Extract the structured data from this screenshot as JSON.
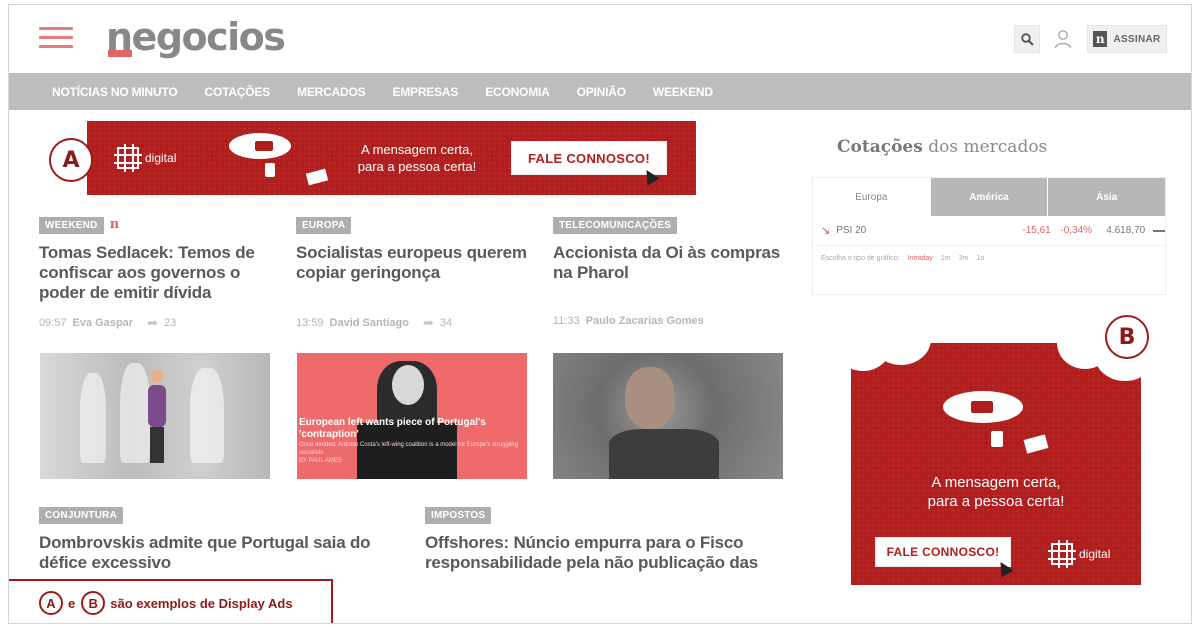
{
  "header": {
    "logo": "negocios",
    "assinar_label": "ASSINAR",
    "assinar_badge": "n"
  },
  "nav": {
    "items": [
      "NOTÍCIAS NO MINUTO",
      "COTAÇÕES",
      "MERCADOS",
      "EMPRESAS",
      "ECONOMIA",
      "OPINIÃO",
      "WEEKEND"
    ]
  },
  "ad_a": {
    "label": "A",
    "brand": "digital",
    "message_line1": "A mensagem certa,",
    "message_line2": "para a pessoa certa!",
    "cta": "FALE CONNOSCO!"
  },
  "ad_b": {
    "label": "B",
    "brand": "digital",
    "message_line1": "A mensagem certa,",
    "message_line2": "para a pessoa certa!",
    "cta": "FALE CONNOSCO!"
  },
  "articles": [
    {
      "tag": "WEEKEND",
      "tag_badge": "n",
      "headline": "Tomas Sedlacek: Temos de confiscar aos governos o poder de emitir dívida",
      "time": "09:57",
      "author": "Eva Gaspar",
      "shares": "23"
    },
    {
      "tag": "EUROPA",
      "headline": "Socialistas europeus querem copiar geringonça",
      "time": "13:59",
      "author": "David Santiago",
      "shares": "34"
    },
    {
      "tag": "TELECOMUNICAÇÕES",
      "headline": "Accionista da Oi às compras na Pharol",
      "time": "11:33",
      "author": "Paulo Zacarias Gomes",
      "shares": ""
    }
  ],
  "photo_caption": {
    "title": "European left wants piece of Portugal's 'contraption'",
    "text": "Once derided, António Costa's left-wing coalition is a model for Europe's struggling socialists",
    "byline": "BY PAUL AMES"
  },
  "bottom_articles": [
    {
      "tag": "CONJUNTURA",
      "headline": "Dombrovskis admite que Portugal saia do défice excessivo"
    },
    {
      "tag": "IMPOSTOS",
      "headline": "Offshores: Núncio empurra para o Fisco responsabilidade pela não publicação das"
    }
  ],
  "cotacoes": {
    "title_bold": "Cotações",
    "title_rest": " dos mercados",
    "tabs": [
      "Europa",
      "América",
      "Ásia"
    ],
    "row": {
      "index": "PSI 20",
      "change": "-15,61",
      "percent": "-0,34%",
      "value": "4.618,70"
    },
    "chart_label": "Escolha o tipo de gráfico:",
    "chart_options": [
      "Intraday",
      "1m",
      "3m",
      "1a"
    ]
  },
  "caption": {
    "a": "A",
    "e": "e",
    "b": "B",
    "text": "são exemplos de Display Ads"
  },
  "colors": {
    "brand_red": "#b01e1e",
    "accent_red": "#9c1c1c",
    "nav_gray": "#bdbdbd"
  }
}
